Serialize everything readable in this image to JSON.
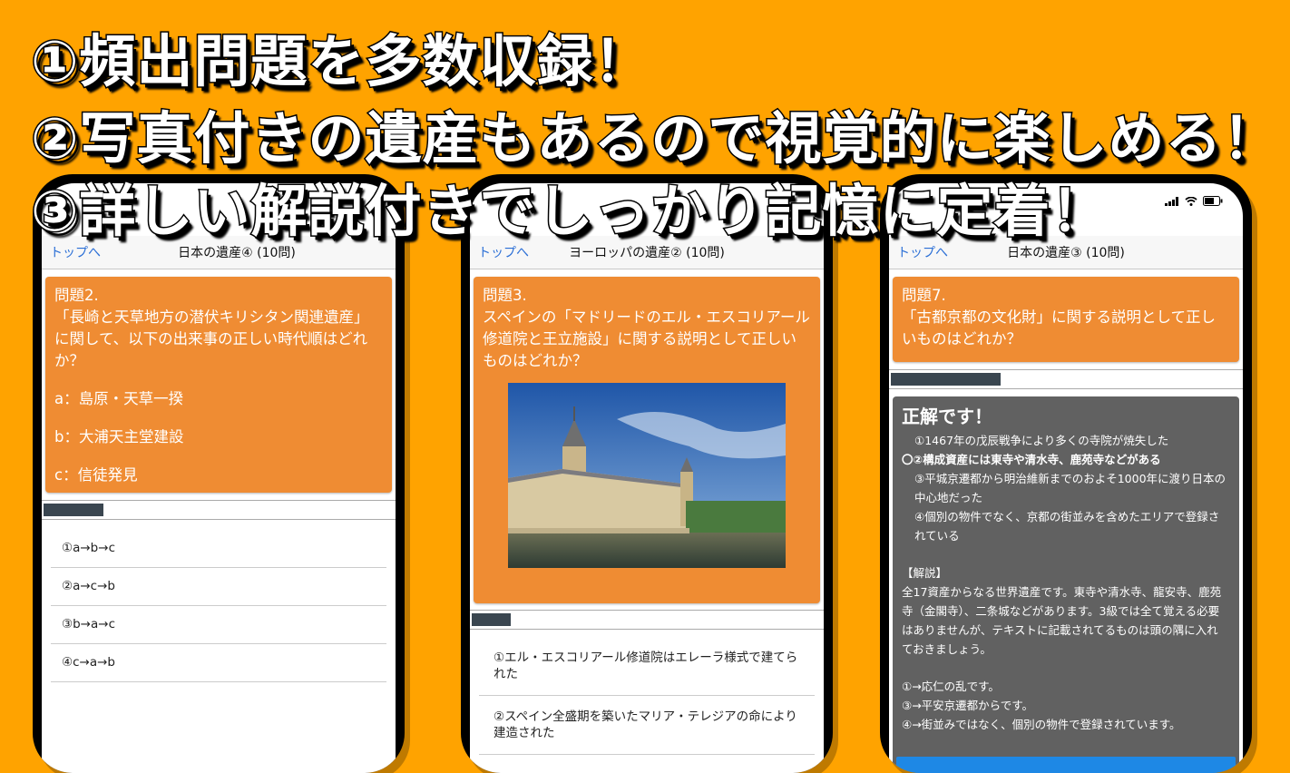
{
  "headlines": [
    "①頻出問題を多数収録！",
    "②写真付きの遺産もあるので視覚的に楽しめる！",
    "③詳しい解説付きでしっかり記憶に定着！"
  ],
  "phones": [
    {
      "back": "トップへ",
      "title": "日本の遺産④ (10問)",
      "question_number": "問題2.",
      "question": "「長崎と天草地方の潜伏キリシタン関連遺産」に関して、以下の出来事の正しい時代順はどれか？",
      "items": [
        "a：島原・天草一揆",
        "b：大浦天主堂建設",
        "c：信徒発見"
      ],
      "answers": [
        "①a→b→c",
        "②a→c→b",
        "③b→a→c",
        "④c→a→b"
      ],
      "progress": 0.17
    },
    {
      "back": "トップへ",
      "title": "ヨーロッパの遺産② (10問)",
      "question_number": "問題3.",
      "question": "スペインの「マドリードのエル・エスコリアール修道院と王立施設」に関する説明として正しいものはどれか？",
      "answers": [
        "①エル・エスコリアール修道院はエレーラ様式で建てられた",
        "②スペイン全盛期を築いたマリア・テレジアの命により建造された"
      ],
      "progress": 0.11
    },
    {
      "back": "トップへ",
      "title": "日本の遺産③ (10問)",
      "question_number": "問題7.",
      "question": "「古都京都の文化財」に関する説明として正しいものはどれか？",
      "progress": 0.31,
      "result_title": "正解です！",
      "choices": [
        "①1467年の戊辰戦争により多くの寺院が焼失した",
        "〇②構成資産には東寺や清水寺、鹿苑寺などがある",
        "③平城京遷都から明治維新までのおよそ1000年に渡り日本の中心地だった",
        "④個別の物件でなく、京都の街並みを含めたエリアで登録されている"
      ],
      "explanation_heading": "【解説】",
      "explanation": "全17資産からなる世界遺産です。東寺や清水寺、龍安寺、鹿苑寺（金閣寺）、二条城などがあります。3級では全て覚える必要はありませんが、テキストに記載されてるものは頭の隅に入れておきましょう。",
      "notes": [
        "①→応仁の乱です。",
        "③→平安京遷都からです。",
        "④→街並みではなく、個別の物件で登録されています。"
      ]
    }
  ]
}
